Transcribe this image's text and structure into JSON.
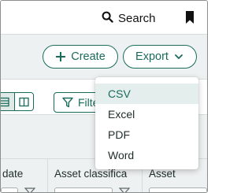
{
  "header": {
    "search_label": "Search",
    "search_icon": "magnifier",
    "bookmark_icon": "bookmark"
  },
  "actions": {
    "create_label": "Create",
    "export_label": "Export"
  },
  "toolbar": {
    "filter_label": "Filter"
  },
  "table": {
    "columns": [
      {
        "label": "date"
      },
      {
        "label": "Asset classifica"
      },
      {
        "label": "Asset"
      }
    ]
  },
  "export_menu": {
    "items": [
      {
        "label": "CSV",
        "highlighted": true
      },
      {
        "label": "Excel"
      },
      {
        "label": "PDF"
      },
      {
        "label": "Word"
      }
    ]
  },
  "colors": {
    "accent": "#1a6b5c",
    "background": "#eef1f1",
    "menu_highlight": "#e4eeec"
  }
}
